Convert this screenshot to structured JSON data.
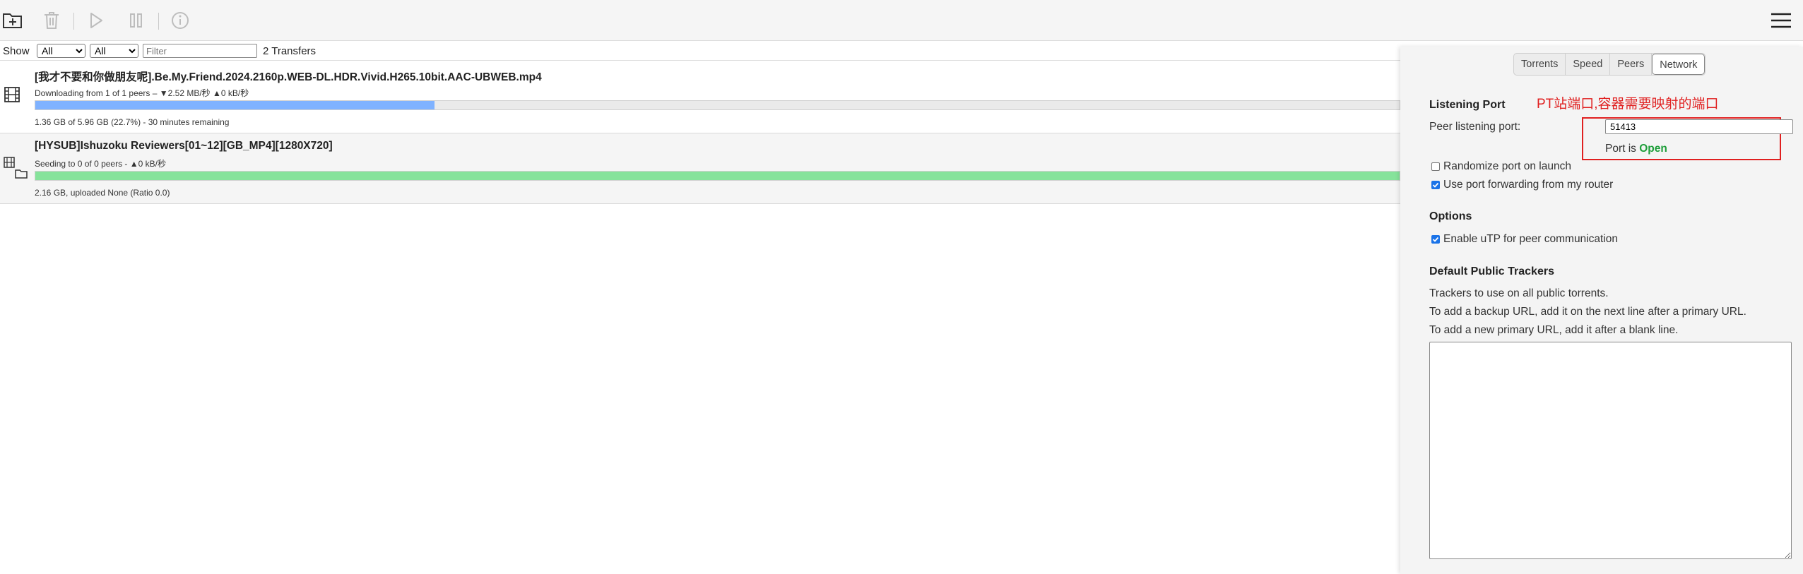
{
  "toolbar": {
    "buttons": [
      {
        "icon": "folder-plus-icon"
      },
      {
        "icon": "trash-icon"
      },
      {
        "icon": "play-icon"
      },
      {
        "icon": "pause-icon"
      },
      {
        "icon": "info-icon"
      },
      {
        "icon": "hamburger-menu-icon"
      }
    ]
  },
  "filter": {
    "show_label": "Show",
    "state_selected": "All",
    "tracker_selected": "All",
    "filter_placeholder": "Filter",
    "transfer_count": "2 Transfers"
  },
  "torrents": [
    {
      "name": "[我才不要和你做朋友呢].Be.My.Friend.2024.2160p.WEB-DL.HDR.Vivid.H265.10bit.AAC-UBWEB.mp4",
      "peers": "Downloading from 1 of 1 peers – ▼2.52 MB/秒 ▲0 kB/秒",
      "progress_text": "1.36 GB of 5.96 GB (22.7%) - 30 minutes remaining",
      "progress": 22.7,
      "bar_color": "#7fb2ff",
      "icon": "film-icon"
    },
    {
      "name": "[HYSUB]Ishuzoku Reviewers[01~12][GB_MP4][1280X720]",
      "peers": "Seeding to 0 of 0 peers - ▲0 kB/秒",
      "progress_text": "2.16 GB, uploaded None (Ratio 0.0)",
      "progress": 100,
      "bar_color": "#86e39b",
      "icon": "film-folder-icon"
    }
  ],
  "inspector": {
    "tabs": [
      "Torrents",
      "Speed",
      "Peers",
      "Network"
    ],
    "active_tab": "Network",
    "annotation": "PT站端口,容器需要映射的端口",
    "listening": {
      "title": "Listening Port",
      "peer_port_label": "Peer listening port:",
      "peer_port_value": "51413",
      "port_status_prefix": "Port is",
      "port_status": "Open",
      "randomize_label": "Randomize port on launch",
      "randomize_checked": false,
      "forwarding_label": "Use port forwarding from my router",
      "forwarding_checked": true
    },
    "options": {
      "title": "Options",
      "utp_label": "Enable uTP for peer communication",
      "utp_checked": true
    },
    "trackers": {
      "title": "Default Public Trackers",
      "line1": "Trackers to use on all public torrents.",
      "line2": "To add a backup URL, add it on the next line after a primary URL.",
      "line3": "To add a new primary URL, add it after a blank line.",
      "value": ""
    }
  },
  "colors": {
    "open_status": "#1e9e3a",
    "annotation": "#e02020",
    "checkbox_on": "#1a73e8"
  }
}
